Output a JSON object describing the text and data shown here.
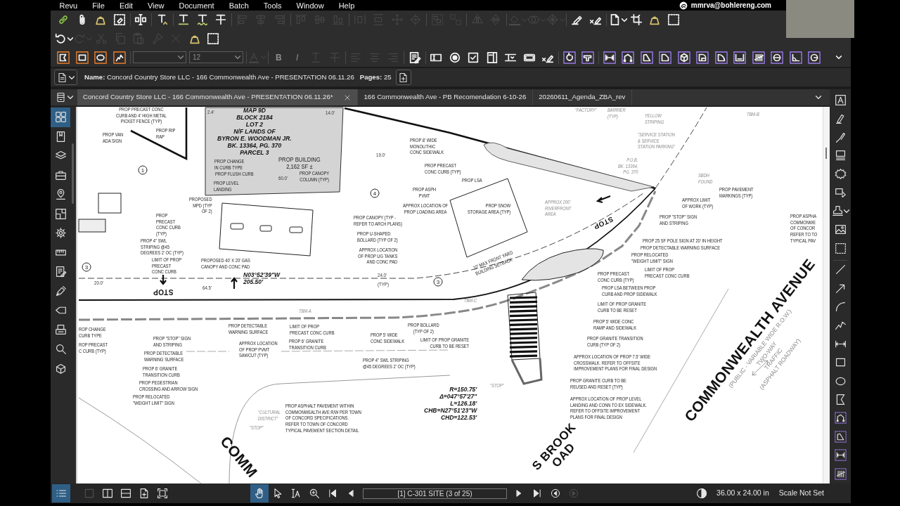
{
  "menu": [
    "Revu",
    "File",
    "Edit",
    "View",
    "Document",
    "Batch",
    "Tools",
    "Window",
    "Help"
  ],
  "account": "mmrva@bohlereng.com",
  "toolbars": [
    [
      {
        "disabled": false
      },
      {
        "disabled": false
      },
      {
        "disabled": false
      },
      {
        "disabled": false
      },
      {
        "disabled": false
      },
      {
        "disabled": false
      },
      {
        "disabled": false
      },
      {
        "disabled": false
      },
      {
        "disabled": false
      },
      {
        "disabled": true
      },
      {
        "disabled": true
      },
      {
        "disabled": true
      },
      {
        "disabled": true
      },
      {
        "disabled": true
      },
      {
        "disabled": true
      },
      {
        "disabled": true
      },
      {
        "disabled": true
      },
      {
        "disabled": true
      },
      {
        "disabled": true
      },
      {
        "disabled": true
      },
      {
        "disabled": true
      },
      {
        "disabled": true
      },
      {
        "disabled": true
      },
      {
        "disabled": true
      },
      {
        "disabled": true
      },
      {
        "disabled": true
      },
      {
        "disabled": false
      },
      {
        "disabled": false
      },
      {
        "disabled": false
      },
      {
        "disabled": false
      },
      {
        "disabled": false
      },
      {
        "disabled": false
      }
    ],
    [
      {
        "disabled": false
      },
      {
        "disabled": true
      },
      {
        "disabled": true
      },
      {
        "disabled": true
      },
      {
        "disabled": true
      },
      {
        "disabled": true
      },
      {
        "disabled": true
      },
      {
        "disabled": false
      },
      {
        "disabled": false
      }
    ],
    [
      {
        "disabled": false
      },
      {
        "disabled": false
      },
      {
        "disabled": false
      },
      {
        "disabled": false
      },
      {
        "disabled": true
      },
      {
        "disabled": true,
        "label": "B"
      },
      {
        "disabled": true,
        "label": "I"
      },
      {
        "disabled": true
      },
      {
        "disabled": true
      },
      {
        "disabled": true
      },
      {
        "disabled": true
      },
      {
        "disabled": true
      },
      {
        "disabled": false
      },
      {
        "disabled": false
      },
      {
        "disabled": false
      },
      {
        "disabled": false
      },
      {
        "disabled": false
      },
      {
        "disabled": false
      },
      {
        "disabled": false
      },
      {
        "disabled": false
      },
      {
        "disabled": false
      },
      {
        "disabled": false
      },
      {
        "disabled": false
      },
      {
        "disabled": false
      },
      {
        "disabled": false
      },
      {
        "disabled": false
      },
      {
        "disabled": false
      },
      {
        "disabled": false
      },
      {
        "disabled": false
      },
      {
        "disabled": false
      },
      {
        "disabled": false
      },
      {
        "disabled": false
      },
      {
        "disabled": false
      },
      {
        "disabled": false
      }
    ]
  ],
  "font_size": "12",
  "document": {
    "name": "**Name:** Concord Country Store LLC - 166 Commonwealth Ave - PRESENTATION 06.11.26",
    "pages": "**Pages:** 25"
  },
  "tabs": [
    {
      "label": "Concord Country Store LLC - 166 Commonwealth Ave - PRESENTATION 06.11.26*",
      "selected": true
    },
    {
      "label": "166 Commonwealth Ave - PB Recomendation 6-10-26",
      "selected": false
    },
    {
      "label": "20260611_Agenda_ZBA_rev",
      "selected": false
    }
  ],
  "left_panel": [
    {
      "selected": true
    },
    {
      "selected": false
    },
    {
      "selected": false
    },
    {
      "selected": false
    },
    {
      "selected": false
    },
    {
      "selected": false
    },
    {
      "selected": false
    },
    {
      "selected": false
    },
    {
      "selected": false
    },
    {
      "selected": false
    },
    {
      "selected": false
    },
    {
      "selected": false
    },
    {
      "selected": false
    },
    {
      "selected": false
    }
  ],
  "drawing": {
    "labels": [
      {
        "kind": "note",
        "lines": [
          "PROP PRECAST CONC",
          "CURB AND 4' HIGH METAL",
          "PICKET FENCE (TYP)"
        ]
      },
      {
        "kind": "note",
        "lines": [
          "PROP VAN",
          "ADA SIGN"
        ]
      },
      {
        "kind": "note",
        "lines": [
          "PROP RIP",
          "RAP"
        ]
      },
      {
        "kind": "dim",
        "lines": [
          "2.4'"
        ]
      },
      {
        "kind": "title",
        "lines": [
          "MAP 9D",
          "BLOCK 2184",
          "LOT 2",
          "N/F LANDS OF",
          "BYRON E. WOODMAN JR.",
          "BK. 13364, PG. 370",
          "PARCEL 3"
        ]
      },
      {
        "kind": "dim",
        "lines": [
          "14.0'"
        ]
      },
      {
        "kind": "dim",
        "lines": [
          "19.0'"
        ]
      },
      {
        "kind": "note",
        "lines": [
          "PROP 8' WIDE",
          "MONOLITHIC",
          "CONC SIDEWALK"
        ]
      },
      {
        "kind": "ghost",
        "lines": [
          "\"FACTORY\""
        ]
      },
      {
        "kind": "ghost",
        "lines": [
          "BARRIER",
          "(TYP)"
        ]
      },
      {
        "kind": "ghost",
        "lines": [
          "YELLOW",
          "STRIPING"
        ]
      },
      {
        "kind": "ghost",
        "lines": [
          "\"SERVICE STATION",
          "& SERVICE",
          "STATION PARKING\""
        ]
      },
      {
        "kind": "ghost",
        "lines": [
          "TBM-B"
        ]
      },
      {
        "kind": "circle",
        "lines": [
          "1"
        ]
      },
      {
        "kind": "note",
        "lines": [
          "PROP CHANGE",
          "IN CURB TYPE"
        ]
      },
      {
        "kind": "note",
        "lines": [
          "PROP FLUSH CURB"
        ]
      },
      {
        "kind": "note",
        "lines": [
          "PROP LEVEL",
          "LANDING"
        ]
      },
      {
        "kind": "bldg",
        "lines": [
          "PROP BUILDING",
          "2,162 SF ±"
        ]
      },
      {
        "kind": "dim",
        "lines": [
          "60.0'"
        ]
      },
      {
        "kind": "note",
        "lines": [
          "PROP CANOPY",
          "COLUMN (TYP)"
        ]
      },
      {
        "kind": "note",
        "lines": [
          "PROP PRECAST",
          "CONC CURB (TYP)"
        ]
      },
      {
        "kind": "note",
        "lines": [
          "PROP LSA"
        ]
      },
      {
        "kind": "ghost",
        "lines": [
          "P.O.B.",
          "BK. 13364,",
          "PG. 370"
        ]
      },
      {
        "kind": "ghost",
        "lines": [
          "SBDH",
          "FOUND"
        ]
      },
      {
        "kind": "note",
        "lines": [
          "PROPOSED",
          "MPD (TYP",
          "OF 2)"
        ]
      },
      {
        "kind": "circle",
        "lines": [
          "4"
        ]
      },
      {
        "kind": "note",
        "lines": [
          "PROP ASPH",
          "PVMT"
        ]
      },
      {
        "kind": "note",
        "lines": [
          "APPROX LOCATION OF",
          "PROP LOADING AREA"
        ]
      },
      {
        "kind": "note",
        "lines": [
          "PROP SNOW",
          "STORAGE AREA (TYP)"
        ]
      },
      {
        "kind": "ghost",
        "lines": [
          "APPROX 200'",
          "RIVERFRONT",
          "AREA"
        ]
      },
      {
        "kind": "note",
        "lines": [
          "APPROX LIMIT",
          "OF WORK (TYP)"
        ]
      },
      {
        "kind": "note",
        "lines": [
          "PROP PAVEMENT",
          "MARKINGS (TYP)"
        ]
      },
      {
        "kind": "note",
        "lines": [
          "PROP",
          "PRECAST",
          "CONC CURB",
          "(TYP)"
        ]
      },
      {
        "kind": "note",
        "lines": [
          "PROP CANOPY (TYP -",
          "REFER TO ARCH PLANS)"
        ]
      },
      {
        "kind": "stop",
        "lines": [
          "STOP"
        ]
      },
      {
        "kind": "note",
        "lines": [
          "PROP \"STOP\" SIGN",
          "AND STRIPING"
        ]
      },
      {
        "kind": "note",
        "lines": [
          "PROP U-SHAPED",
          "BOLLARD (TYP OF 2)"
        ]
      },
      {
        "kind": "note",
        "lines": [
          "PROP 4\" SWL",
          "STRIPING @45",
          "DEGREES 2' OC (TYP)"
        ]
      },
      {
        "kind": "note",
        "lines": [
          "PROP 25 SF POLE SIGN AT 20' IN HEIGHT"
        ]
      },
      {
        "kind": "note",
        "lines": [
          "PROP ASPHA",
          "COMMONWE",
          "OF CONCOR",
          "REFER TO TO",
          "TYPICAL PAV"
        ]
      },
      {
        "kind": "note",
        "lines": [
          "APPROX LOCATION",
          "OF PROP UG TANKS",
          "AND CONC PAD"
        ]
      },
      {
        "kind": "note",
        "lines": [
          "PROP DETECTABLE WARNING SURFACE"
        ]
      },
      {
        "kind": "circle",
        "lines": [
          "3"
        ]
      },
      {
        "kind": "note",
        "lines": [
          "LIMIT OF PROP",
          "PRECAST",
          "CONC CURB"
        ]
      },
      {
        "kind": "note",
        "lines": [
          "PROPOSED 40' X 20' GAS",
          "CANOPY AND CONC PAD"
        ]
      },
      {
        "kind": "dim",
        "lines": [
          "20.0'"
        ]
      },
      {
        "kind": "title",
        "lines": [
          "N03°52'39\"W",
          "205.50'"
        ]
      },
      {
        "kind": "dim",
        "lines": [
          "24.0'"
        ]
      },
      {
        "kind": "note",
        "lines": [
          "10' MAX FRONT YARD",
          "BUILDING SETBACK"
        ]
      },
      {
        "kind": "note",
        "lines": [
          "PROP RELOCATED",
          "\"WEIGHT LIMIT\" SIGN"
        ]
      },
      {
        "kind": "stop",
        "lines": [
          "STOP"
        ]
      },
      {
        "kind": "dim",
        "lines": [
          "64.5'"
        ]
      },
      {
        "kind": "dim",
        "lines": [
          "(TYP)"
        ]
      },
      {
        "kind": "circle",
        "lines": [
          "3"
        ]
      },
      {
        "kind": "note",
        "lines": [
          "PROP PRECAST",
          "CONC CURB (TYP)"
        ]
      },
      {
        "kind": "note",
        "lines": [
          "LIMIT OF PROP",
          "PRECAST CONC CURB"
        ]
      },
      {
        "kind": "note",
        "lines": [
          "PROP LSA BETWEEN PROP",
          "CURB AND PROP SIDEWALK"
        ]
      },
      {
        "kind": "ghost",
        "lines": [
          "TBM-C"
        ]
      },
      {
        "kind": "ghost",
        "lines": [
          "TBM-A"
        ]
      },
      {
        "kind": "note",
        "lines": [
          "LIMIT OF PROP GRANITE",
          "CURB TO BE RESET"
        ]
      },
      {
        "kind": "note",
        "lines": [
          "ROP CHANGE",
          "CURB TYPE"
        ]
      },
      {
        "kind": "note",
        "lines": [
          "PROP DETECTABLE",
          "WARNING SURFACE"
        ]
      },
      {
        "kind": "note",
        "lines": [
          "LIMIT OF PROP",
          "PRECAST CONC CURB"
        ]
      },
      {
        "kind": "note",
        "lines": [
          "PROP BOLLARD",
          "(TYP OF 2)"
        ]
      },
      {
        "kind": "note",
        "lines": [
          "PROP 5' WIDE CONC",
          "RAMP AND SIDEWALK"
        ]
      },
      {
        "kind": "note",
        "lines": [
          "ROP PRECAST",
          "C CURB (TYP)"
        ]
      },
      {
        "kind": "note",
        "lines": [
          "PROP \"STOP\" SIGN",
          "AND STRIPING"
        ]
      },
      {
        "kind": "note",
        "lines": [
          "PROP DETECTABLE",
          "WARNING SURFACE"
        ]
      },
      {
        "kind": "note",
        "lines": [
          "APPROX LOCATION",
          "OF PROP PVMT",
          "SAWCUT (TYP)"
        ]
      },
      {
        "kind": "note",
        "lines": [
          "PROP 6' GRANITE",
          "TRANSITION CURB"
        ]
      },
      {
        "kind": "note",
        "lines": [
          "PROP 5' WIDE",
          "CONC SIDEWALK"
        ]
      },
      {
        "kind": "note",
        "lines": [
          "LIMIT OF PROP GRANITE",
          "CURB TO BE RESET"
        ]
      },
      {
        "kind": "note",
        "lines": [
          "PROP GRANITE TRANSITION",
          "CURB (TYP OF 2)"
        ]
      },
      {
        "kind": "note",
        "lines": [
          "PROP 6' GRANITE",
          "TRANSITION CURB"
        ]
      },
      {
        "kind": "note",
        "lines": [
          "PROP 4\" SWL STRIPING",
          "@45 DEGREES 2' OC (TYP)"
        ]
      },
      {
        "kind": "note",
        "lines": [
          "APPROX LOCATION OF PROP 7.5' WIDE",
          "CROSSWALK. REFER TO OFFSITE",
          "IMPROVEMENT PLANS FOR FINAL DESIGN"
        ]
      },
      {
        "kind": "note",
        "lines": [
          "PROP PEDESTRIAN",
          "CROSSING AND ARROW SIGN"
        ]
      },
      {
        "kind": "note",
        "lines": [
          "PROP RELOCATED",
          "\"WEIGHT LIMIT\" SIGN"
        ]
      },
      {
        "kind": "ghost",
        "lines": [
          "\"CULTURAL",
          "DISTRICT\""
        ]
      },
      {
        "kind": "ghost",
        "lines": [
          "\"STOP\""
        ]
      },
      {
        "kind": "note",
        "lines": [
          "PROP ASPHALT PAVEMENT WITHIN",
          "COMMONWEALTH AVE R/W PER TOWN",
          "OF CONCORD SPECIFICATIONS.",
          "REFER TO TOWN OF CONCORD",
          "TYPICAL PAVEMENT SECTION DETAIL"
        ]
      },
      {
        "kind": "title",
        "lines": [
          "R=150.75'",
          "Δ=047°57'27\"",
          "L=126.18'",
          "CHB=N27°51'23\"W",
          "CHD=122.53'"
        ]
      },
      {
        "kind": "ghost",
        "lines": [
          "\"STOP\""
        ]
      },
      {
        "kind": "note",
        "lines": [
          "PROP GRANITE CURB TO BE",
          "REUSED AND RESET (TYP)"
        ]
      },
      {
        "kind": "note",
        "lines": [
          "APPROX LOCATION OF PROP LEVEL",
          "LANDING AND CONN TO EX SIDEWALK.",
          "REFER TO OFFSITE IMPROVEMENT",
          "PLANS FOR FINAL DESIGN"
        ]
      },
      {
        "kind": "road",
        "lines": [
          "COMM"
        ]
      },
      {
        "kind": "road",
        "lines": [
          "S BROOK",
          "OAD"
        ]
      },
      {
        "kind": "road",
        "lines": [
          "COMMONWEALTH AVENUE"
        ]
      },
      {
        "kind": "roadnote",
        "lines": [
          "(PUBLIC - VARIABLE WIDE R.O.W.)",
          "TWO-WAY",
          "TRAFFIC",
          "(ASPHALT ROADWAY)"
        ]
      }
    ]
  },
  "status_bar": {
    "view_buttons": [
      {
        "selected": true,
        "disabled": false
      },
      {
        "selected": false,
        "disabled": true
      },
      {
        "selected": false,
        "disabled": false
      },
      {
        "selected": false,
        "disabled": false
      },
      {
        "selected": false,
        "disabled": false
      },
      {
        "selected": false,
        "disabled": false
      }
    ],
    "tools": [
      {
        "selected": true
      },
      {
        "selected": false
      },
      {
        "selected": false
      },
      {
        "selected": false
      }
    ],
    "nav_buttons": [
      {
        "disabled": false
      },
      {
        "disabled": false
      },
      {
        "disabled": false
      },
      {
        "disabled": false
      },
      {
        "disabled": false
      },
      {
        "disabled": true
      }
    ],
    "page": "[1] C-301 SITE (3 of 25)",
    "page_size": "36.00 x 24.00 in",
    "scale": "Scale Not Set"
  }
}
